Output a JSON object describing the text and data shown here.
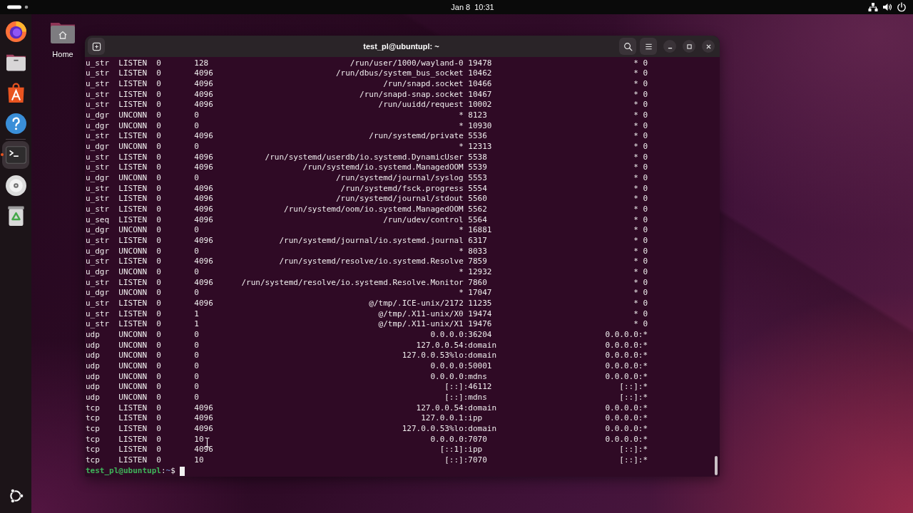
{
  "top_bar": {
    "clock": {
      "date": "Jan 8",
      "time": "10:31"
    }
  },
  "dock": {
    "groups": [
      {
        "items": [
          {
            "kind": "browser",
            "running": false,
            "selected": false
          },
          {
            "kind": "files",
            "running": false,
            "selected": false
          },
          {
            "kind": "store",
            "running": false,
            "selected": false
          },
          {
            "kind": "help",
            "running": false,
            "selected": false
          }
        ]
      },
      {
        "items": [
          {
            "kind": "terminal",
            "running": true,
            "selected": true
          },
          {
            "kind": "disc",
            "running": false,
            "selected": false
          },
          {
            "kind": "trash",
            "running": false,
            "selected": false
          }
        ]
      }
    ]
  },
  "desktop": {
    "icons": [
      {
        "label": "Home"
      }
    ]
  },
  "terminal": {
    "title": "test_pl@ubuntupl: ~",
    "rows": [
      {
        "kind": "unix",
        "netid": "u_str",
        "state": "LISTEN",
        "recv_q": "0",
        "send_q": "128",
        "local_address": "/run/user/1000/wayland-0",
        "local_port": "19478",
        "peer": "* 0"
      },
      {
        "kind": "unix",
        "netid": "u_str",
        "state": "LISTEN",
        "recv_q": "0",
        "send_q": "4096",
        "local_address": "/run/dbus/system_bus_socket",
        "local_port": "10462",
        "peer": "* 0"
      },
      {
        "kind": "unix",
        "netid": "u_str",
        "state": "LISTEN",
        "recv_q": "0",
        "send_q": "4096",
        "local_address": "/run/snapd.socket",
        "local_port": "10466",
        "peer": "* 0"
      },
      {
        "kind": "unix",
        "netid": "u_str",
        "state": "LISTEN",
        "recv_q": "0",
        "send_q": "4096",
        "local_address": "/run/snapd-snap.socket",
        "local_port": "10467",
        "peer": "* 0"
      },
      {
        "kind": "unix",
        "netid": "u_str",
        "state": "LISTEN",
        "recv_q": "0",
        "send_q": "4096",
        "local_address": "/run/uuidd/request",
        "local_port": "10002",
        "peer": "* 0"
      },
      {
        "kind": "unix",
        "netid": "u_dgr",
        "state": "UNCONN",
        "recv_q": "0",
        "send_q": "0",
        "local_address": "*",
        "local_port": "8123",
        "peer": "* 0"
      },
      {
        "kind": "unix",
        "netid": "u_dgr",
        "state": "UNCONN",
        "recv_q": "0",
        "send_q": "0",
        "local_address": "*",
        "local_port": "10930",
        "peer": "* 0"
      },
      {
        "kind": "unix",
        "netid": "u_str",
        "state": "LISTEN",
        "recv_q": "0",
        "send_q": "4096",
        "local_address": "/run/systemd/private",
        "local_port": "5536",
        "peer": "* 0"
      },
      {
        "kind": "unix",
        "netid": "u_dgr",
        "state": "UNCONN",
        "recv_q": "0",
        "send_q": "0",
        "local_address": "*",
        "local_port": "12313",
        "peer": "* 0"
      },
      {
        "kind": "unix",
        "netid": "u_str",
        "state": "LISTEN",
        "recv_q": "0",
        "send_q": "4096",
        "local_address": "/run/systemd/userdb/io.systemd.DynamicUser",
        "local_port": "5538",
        "peer": "* 0"
      },
      {
        "kind": "unix",
        "netid": "u_str",
        "state": "LISTEN",
        "recv_q": "0",
        "send_q": "4096",
        "local_address": "/run/systemd/io.systemd.ManagedOOM",
        "local_port": "5539",
        "peer": "* 0"
      },
      {
        "kind": "unix",
        "netid": "u_dgr",
        "state": "UNCONN",
        "recv_q": "0",
        "send_q": "0",
        "local_address": "/run/systemd/journal/syslog",
        "local_port": "5553",
        "peer": "* 0"
      },
      {
        "kind": "unix",
        "netid": "u_str",
        "state": "LISTEN",
        "recv_q": "0",
        "send_q": "4096",
        "local_address": "/run/systemd/fsck.progress",
        "local_port": "5554",
        "peer": "* 0"
      },
      {
        "kind": "unix",
        "netid": "u_str",
        "state": "LISTEN",
        "recv_q": "0",
        "send_q": "4096",
        "local_address": "/run/systemd/journal/stdout",
        "local_port": "5560",
        "peer": "* 0"
      },
      {
        "kind": "unix",
        "netid": "u_str",
        "state": "LISTEN",
        "recv_q": "0",
        "send_q": "4096",
        "local_address": "/run/systemd/oom/io.systemd.ManagedOOM",
        "local_port": "5562",
        "peer": "* 0"
      },
      {
        "kind": "unix",
        "netid": "u_seq",
        "state": "LISTEN",
        "recv_q": "0",
        "send_q": "4096",
        "local_address": "/run/udev/control",
        "local_port": "5564",
        "peer": "* 0"
      },
      {
        "kind": "unix",
        "netid": "u_dgr",
        "state": "UNCONN",
        "recv_q": "0",
        "send_q": "0",
        "local_address": "*",
        "local_port": "16881",
        "peer": "* 0"
      },
      {
        "kind": "unix",
        "netid": "u_str",
        "state": "LISTEN",
        "recv_q": "0",
        "send_q": "4096",
        "local_address": "/run/systemd/journal/io.systemd.journal",
        "local_port": "6317",
        "peer": "* 0"
      },
      {
        "kind": "unix",
        "netid": "u_dgr",
        "state": "UNCONN",
        "recv_q": "0",
        "send_q": "0",
        "local_address": "*",
        "local_port": "8033",
        "peer": "* 0"
      },
      {
        "kind": "unix",
        "netid": "u_str",
        "state": "LISTEN",
        "recv_q": "0",
        "send_q": "4096",
        "local_address": "/run/systemd/resolve/io.systemd.Resolve",
        "local_port": "7859",
        "peer": "* 0"
      },
      {
        "kind": "unix",
        "netid": "u_dgr",
        "state": "UNCONN",
        "recv_q": "0",
        "send_q": "0",
        "local_address": "*",
        "local_port": "12932",
        "peer": "* 0"
      },
      {
        "kind": "unix",
        "netid": "u_str",
        "state": "LISTEN",
        "recv_q": "0",
        "send_q": "4096",
        "local_address": "/run/systemd/resolve/io.systemd.Resolve.Monitor",
        "local_port": "7860",
        "peer": "* 0"
      },
      {
        "kind": "unix",
        "netid": "u_dgr",
        "state": "UNCONN",
        "recv_q": "0",
        "send_q": "0",
        "local_address": "*",
        "local_port": "17047",
        "peer": "* 0"
      },
      {
        "kind": "unix",
        "netid": "u_str",
        "state": "LISTEN",
        "recv_q": "0",
        "send_q": "4096",
        "local_address": "@/tmp/.ICE-unix/2172",
        "local_port": "11235",
        "peer": "* 0"
      },
      {
        "kind": "unix",
        "netid": "u_str",
        "state": "LISTEN",
        "recv_q": "0",
        "send_q": "1",
        "local_address": "@/tmp/.X11-unix/X0",
        "local_port": "19474",
        "peer": "* 0"
      },
      {
        "kind": "unix",
        "netid": "u_str",
        "state": "LISTEN",
        "recv_q": "0",
        "send_q": "1",
        "local_address": "@/tmp/.X11-unix/X1",
        "local_port": "19476",
        "peer": "* 0"
      },
      {
        "kind": "inet",
        "netid": "udp",
        "state": "UNCONN",
        "recv_q": "0",
        "send_q": "0",
        "local_address": "0.0.0.0",
        "local_port": ":36204",
        "peer": "0.0.0.0:*"
      },
      {
        "kind": "inet",
        "netid": "udp",
        "state": "UNCONN",
        "recv_q": "0",
        "send_q": "0",
        "local_address": "127.0.0.54",
        "local_port": ":domain",
        "peer": "0.0.0.0:*"
      },
      {
        "kind": "inet",
        "netid": "udp",
        "state": "UNCONN",
        "recv_q": "0",
        "send_q": "0",
        "local_address": "127.0.0.53%lo",
        "local_port": ":domain",
        "peer": "0.0.0.0:*"
      },
      {
        "kind": "inet",
        "netid": "udp",
        "state": "UNCONN",
        "recv_q": "0",
        "send_q": "0",
        "local_address": "0.0.0.0",
        "local_port": ":50001",
        "peer": "0.0.0.0:*"
      },
      {
        "kind": "inet",
        "netid": "udp",
        "state": "UNCONN",
        "recv_q": "0",
        "send_q": "0",
        "local_address": "0.0.0.0",
        "local_port": ":mdns",
        "peer": "0.0.0.0:*"
      },
      {
        "kind": "inet",
        "netid": "udp",
        "state": "UNCONN",
        "recv_q": "0",
        "send_q": "0",
        "local_address": "[::]",
        "local_port": ":46112",
        "peer": "[::]:*"
      },
      {
        "kind": "inet",
        "netid": "udp",
        "state": "UNCONN",
        "recv_q": "0",
        "send_q": "0",
        "local_address": "[::]",
        "local_port": ":mdns",
        "peer": "[::]:*"
      },
      {
        "kind": "inet",
        "netid": "tcp",
        "state": "LISTEN",
        "recv_q": "0",
        "send_q": "4096",
        "local_address": "127.0.0.54",
        "local_port": ":domain",
        "peer": "0.0.0.0:*"
      },
      {
        "kind": "inet",
        "netid": "tcp",
        "state": "LISTEN",
        "recv_q": "0",
        "send_q": "4096",
        "local_address": "127.0.0.1",
        "local_port": ":ipp",
        "peer": "0.0.0.0:*"
      },
      {
        "kind": "inet",
        "netid": "tcp",
        "state": "LISTEN",
        "recv_q": "0",
        "send_q": "4096",
        "local_address": "127.0.0.53%lo",
        "local_port": ":domain",
        "peer": "0.0.0.0:*"
      },
      {
        "kind": "inet",
        "netid": "tcp",
        "state": "LISTEN",
        "recv_q": "0",
        "send_q": "10",
        "local_address": "0.0.0.0",
        "local_port": ":7070",
        "peer": "0.0.0.0:*"
      },
      {
        "kind": "inet",
        "netid": "tcp",
        "state": "LISTEN",
        "recv_q": "0",
        "send_q": "4096",
        "local_address": "[::1]",
        "local_port": ":ipp",
        "peer": "[::]:*"
      },
      {
        "kind": "inet",
        "netid": "tcp",
        "state": "LISTEN",
        "recv_q": "0",
        "send_q": "10",
        "local_address": "[::]",
        "local_port": ":7070",
        "peer": "[::]:*"
      }
    ],
    "prompt": {
      "user_host": "test_pl@ubuntupl",
      "separator": ":",
      "path": "~",
      "symbol": "$"
    }
  }
}
